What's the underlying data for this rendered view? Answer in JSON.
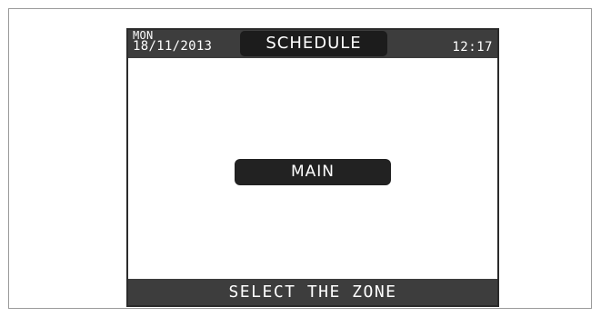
{
  "header": {
    "day_of_week": "MON",
    "date": "18/11/2013",
    "title": "SCHEDULE",
    "time": "12:17"
  },
  "main": {
    "zone_button_label": "MAIN"
  },
  "footer": {
    "message": "SELECT THE ZONE"
  },
  "colors": {
    "bar_background": "#3d3d3d",
    "pill_background": "#1c1c1c",
    "text_on_dark": "#ffffff"
  }
}
